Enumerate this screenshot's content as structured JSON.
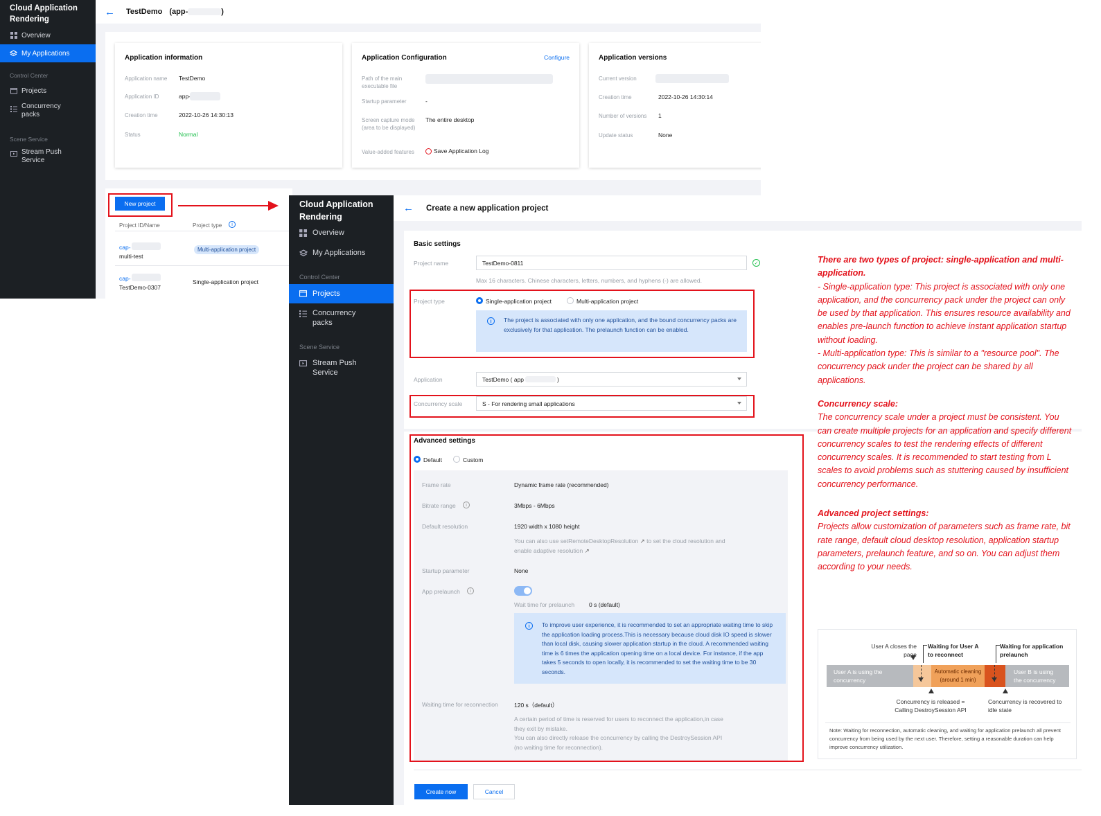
{
  "shot1": {
    "sidebar": {
      "brand": "Cloud Application Rendering",
      "items": [
        {
          "label": "Overview",
          "icon": "grid-icon"
        },
        {
          "label": "My Applications",
          "icon": "layers-icon",
          "active": true
        }
      ],
      "section_control": "Control Center",
      "control_items": [
        {
          "label": "Projects",
          "icon": "folder-icon"
        },
        {
          "label": "Concurrency packs",
          "icon": "list-icon"
        }
      ],
      "section_scene": "Scene Service",
      "scene_items": [
        {
          "label": "Stream Push Service",
          "icon": "stream-icon"
        }
      ]
    },
    "header": {
      "title": "TestDemo",
      "app_prefix": "(app-",
      "app_suffix": ")"
    },
    "app_info": {
      "title": "Application information",
      "name_label": "Application name",
      "name_value": "TestDemo",
      "id_label": "Application ID",
      "id_value": "app-",
      "created_label": "Creation time",
      "created_value": "2022-10-26 14:30:13",
      "status_label": "Status",
      "status_value": "Normal"
    },
    "app_config": {
      "title": "Application Configuration",
      "configure_link": "Configure",
      "path_label": "Path of the main executable file",
      "startup_label": "Startup parameter",
      "startup_value": "-",
      "capture_label": "Screen capture mode (area to be displayed)",
      "capture_value": "The entire desktop",
      "features_label": "Value-added features",
      "features_value": "Save Application Log"
    },
    "app_versions": {
      "title": "Application versions",
      "current_label": "Current version",
      "created_label": "Creation time",
      "created_value": "2022-10-26 14:30:14",
      "count_label": "Number of versions",
      "count_value": "1",
      "update_label": "Update status",
      "update_value": "None"
    },
    "projects": {
      "new_button": "New project",
      "col_id": "Project ID/Name",
      "col_type": "Project type",
      "rows": [
        {
          "id": "cap-",
          "name": "multi-test",
          "type": "Multi-application project"
        },
        {
          "id": "cap-",
          "name": "TestDemo-0307",
          "type": "Single-application project"
        }
      ]
    }
  },
  "shot2": {
    "sidebar": {
      "brand": "Cloud Application Rendering",
      "items": [
        {
          "label": "Overview",
          "icon": "grid-icon"
        },
        {
          "label": "My Applications",
          "icon": "layers-icon"
        }
      ],
      "section_control": "Control Center",
      "control_items": [
        {
          "label": "Projects",
          "icon": "folder-icon",
          "active": true
        },
        {
          "label": "Concurrency packs",
          "icon": "list-icon"
        }
      ],
      "section_scene": "Scene Service",
      "scene_items": [
        {
          "label": "Stream Push Service",
          "icon": "stream-icon"
        }
      ]
    },
    "header": {
      "title": "Create a new application project"
    },
    "basic": {
      "title": "Basic settings",
      "name_label": "Project name",
      "name_value": "TestDemo-0811",
      "name_hint": "Max 16 characters. Chinese characters, letters, numbers, and hyphens (-) are allowed.",
      "type_label": "Project type",
      "type_single": "Single-application project",
      "type_multi": "Multi-application project",
      "type_info": "The project is associated with only one application, and the bound concurrency packs are exclusively for that application. The prelaunch function can be enabled.",
      "app_label": "Application",
      "app_value": "TestDemo ( app",
      "app_suffix": ")",
      "scale_label": "Concurrency scale",
      "scale_value": "S - For rendering small applications"
    },
    "advanced": {
      "title": "Advanced settings",
      "opt_default": "Default",
      "opt_custom": "Custom",
      "frame_label": "Frame rate",
      "frame_value": "Dynamic frame rate (recommended)",
      "bitrate_label": "Bitrate range",
      "bitrate_value": "3Mbps - 6Mbps",
      "res_label": "Default resolution",
      "res_value": "1920 width x 1080 height",
      "res_hint1": "You can also use setRemoteDesktopResolution",
      "res_hint2": "to set the cloud resolution",
      "res_hint3": "and enable adaptive resolution",
      "startup_label": "Startup parameter",
      "startup_value": "None",
      "prelaunch_label": "App prelaunch",
      "wait_label": "Wait time for prelaunch",
      "wait_value": "0 s (default)",
      "prelaunch_info": "To improve user experience, it is recommended to set an appropriate waiting time to skip the application loading process.This is necessary because cloud disk IO speed is slower than local disk, causing slower application startup in the cloud. A recommended waiting time is 6 times the application opening time on a local device. For instance, if the app takes 5 seconds to open locally, it is recommended to set the waiting time to be 30 seconds.",
      "reconnect_label": "Waiting time for reconnection",
      "reconnect_value": "120 s（default）",
      "reconnect_hint1": "A certain period of time is reserved for users to reconnect the application,in case they exit by mistake.",
      "reconnect_hint2": "You can also directly release the concurrency by calling the DestroySession API (no waiting time for reconnection)."
    },
    "actions": {
      "create": "Create now",
      "cancel": "Cancel"
    }
  },
  "annotations": {
    "types_title": "There are two types of project: single-application and multi-application.",
    "types_single": "- Single-application type: This project is associated with only one application, and the concurrency pack under the project can only be used by that application. This ensures resource availability and enables pre-launch function to achieve instant application startup without loading.",
    "types_multi": "- Multi-application type: This is similar to a \"resource pool\". The concurrency pack under the project can be shared by all applications.",
    "scale_title": "Concurrency scale:",
    "scale_body": "The concurrency scale under a project must be consistent. You can create multiple projects for an application and specify different concurrency scales to test the rendering effects of different concurrency scales. It is recommended to start testing from L scales to avoid problems such as stuttering caused by insufficient concurrency performance.",
    "adv_title": "Advanced project settings:",
    "adv_body": "Projects allow customization of parameters such as frame rate, bit rate range, default cloud desktop resolution, application startup parameters, prelaunch feature, and so on. You can adjust them according to your needs."
  },
  "diagram": {
    "userA_closes": "User A closes the page",
    "waiting_user": "Waiting for User A to reconnect",
    "waiting_prelaunch": "Waiting for application prelaunch",
    "seg_a": "User A is using the concurrency",
    "seg_clean": "Automatic cleaning (around 1 min)",
    "seg_b": "User B is using the concurrency",
    "released": "Concurrency is released = Calling DestroySession API",
    "recovered": "Concurrency is recovered to idle state",
    "note": "Note: Waiting for reconnection, automatic cleaning, and waiting for application prelaunch all prevent concurrency from being used by the next user. Therefore, setting a reasonable duration can help improve concurrency utilization.",
    "colors": {
      "grey": "#b7babe",
      "light_orange": "#f5c79a",
      "orange": "#f0a15a",
      "dark_orange": "#d9531e"
    }
  },
  "colors": {
    "accent": "#0a6ef0",
    "sidebar": "#1c2024",
    "highlight": "#e3121b",
    "success": "#1ebf4c"
  }
}
